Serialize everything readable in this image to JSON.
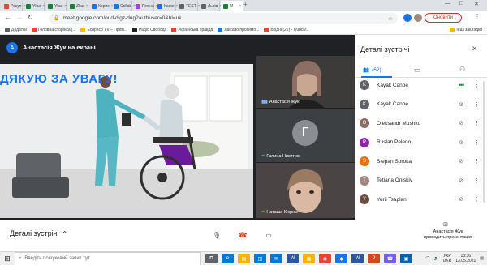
{
  "browser": {
    "tabs": [
      {
        "label": "Резул",
        "color": "#ea4335"
      },
      {
        "label": "Ykur",
        "color": "#188038"
      },
      {
        "label": "Ykur",
        "color": "#188038"
      },
      {
        "label": "Zkur",
        "color": "#188038"
      },
      {
        "label": "Корис",
        "color": "#1a73e8"
      },
      {
        "label": "Collab",
        "color": "#1a73e8"
      },
      {
        "label": "Плена",
        "color": "#a142f4"
      },
      {
        "label": "Кафе",
        "color": "#1a73e8"
      },
      {
        "label": "TEST",
        "color": "#5f6368"
      },
      {
        "label": "Львів",
        "color": "#5f6368"
      },
      {
        "label": "M",
        "color": "#188038",
        "active": true
      }
    ],
    "new_tab": "+",
    "win_min": "—",
    "win_max": "□",
    "win_close": "✕",
    "url": "meet.google.com/oud-djgz-dng?authuser=0&hl=uk",
    "update_label": "Оновити",
    "bookmarks": [
      {
        "label": "Додатки",
        "color": "#5f6368"
      },
      {
        "label": "Головна сторінка |...",
        "color": "#ea4335"
      },
      {
        "label": "Еспресо TV – Прем...",
        "color": "#fbbc04"
      },
      {
        "label": "Радіо Свобода",
        "color": "#202124"
      },
      {
        "label": "Українська правда",
        "color": "#ea4335"
      },
      {
        "label": "Лаікаво просимо...",
        "color": "#1a73e8"
      },
      {
        "label": "Вхідні (22) - lyubciv...",
        "color": "#ea4335"
      }
    ],
    "other_bookmarks": "Інші закладки"
  },
  "meet": {
    "presenter_initial": "A",
    "presenter_label": "Анастасія Жук на екрані",
    "slide_title": "ДЯКУЮ ЗА УВАГУ!",
    "tiles": [
      {
        "name": "Анастасія Жук"
      },
      {
        "name": "Галина Никитюк",
        "initial": "Г"
      },
      {
        "name": "Наташа Кюрюз"
      }
    ]
  },
  "panel": {
    "title": "Деталі зустрічі",
    "people_count": "(62)",
    "participants": [
      {
        "name": "Kayak Canoe",
        "initial": "K",
        "color": "#5f6368",
        "state": "speaking"
      },
      {
        "name": "Kayak Canoe",
        "initial": "K",
        "color": "#5f6368",
        "state": "muted"
      },
      {
        "name": "Oleksandr Mushko",
        "initial": "O",
        "color": "#8d6e63",
        "state": "muted"
      },
      {
        "name": "Ruslan Peleno",
        "initial": "R",
        "color": "#8e24aa",
        "state": "muted"
      },
      {
        "name": "Stepan Soroka",
        "initial": "S",
        "color": "#e8710a",
        "state": "muted"
      },
      {
        "name": "Tetiana Oniskiv",
        "initial": "T",
        "color": "#a1887f",
        "state": "muted"
      },
      {
        "name": "Yurii Tsaplan",
        "initial": "Y",
        "color": "#6d4c41",
        "state": "muted"
      }
    ]
  },
  "bottom": {
    "details_label": "Деталі зустрічі",
    "present_line1": "Анастасія Жук",
    "present_line2": "проводить презентацію"
  },
  "taskbar": {
    "search_placeholder": "Введіть пошуковий запит тут",
    "lang1": "УКР",
    "lang2": "UKR",
    "time": "13:36",
    "date": "13.05.2021",
    "apps": [
      {
        "name": "task-view",
        "color": "#5f6368",
        "glyph": "⧉"
      },
      {
        "name": "edge",
        "color": "#0078d4",
        "glyph": "e"
      },
      {
        "name": "explorer",
        "color": "#f2b600",
        "glyph": "▤"
      },
      {
        "name": "store",
        "color": "#0078d4",
        "glyph": "◫"
      },
      {
        "name": "mail",
        "color": "#0078d4",
        "glyph": "✉"
      },
      {
        "name": "word",
        "color": "#2b579a",
        "glyph": "W"
      },
      {
        "name": "files",
        "color": "#f2b600",
        "glyph": "▦"
      },
      {
        "name": "chrome",
        "color": "#ea4335",
        "glyph": "◉"
      },
      {
        "name": "app-blue",
        "color": "#1a73e8",
        "glyph": "◆"
      },
      {
        "name": "word2",
        "color": "#2b579a",
        "glyph": "W"
      },
      {
        "name": "powerpoint",
        "color": "#d24726",
        "glyph": "P"
      },
      {
        "name": "viber",
        "color": "#7360f2",
        "glyph": "☎"
      },
      {
        "name": "photos",
        "color": "#0063b1",
        "glyph": "▣"
      }
    ]
  }
}
